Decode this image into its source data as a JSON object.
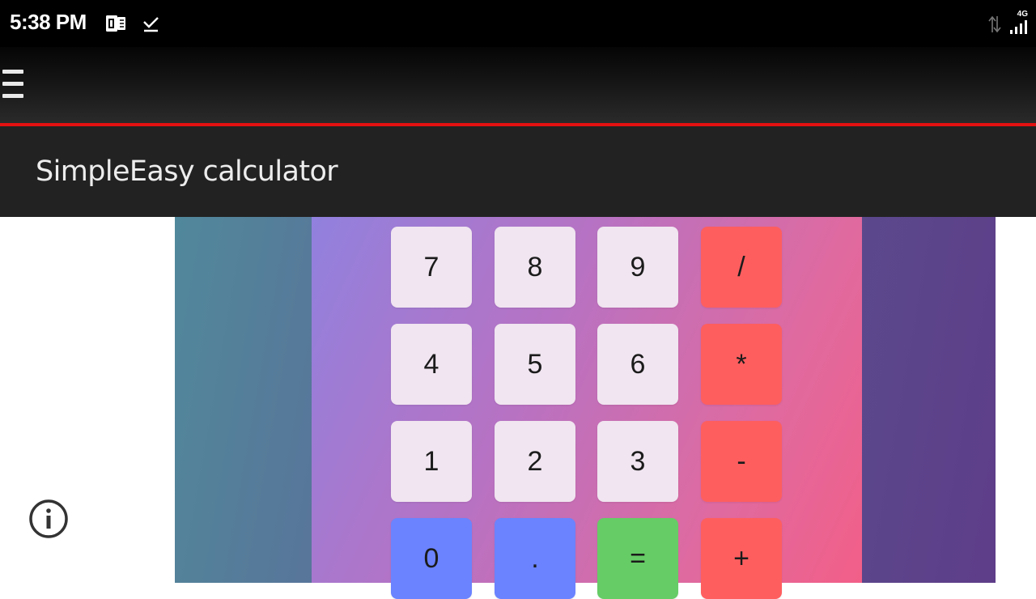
{
  "status_bar": {
    "time": "5:38 PM",
    "icons": [
      "app-notification-icon",
      "download-check-icon",
      "data-arrows-icon",
      "signal-icon"
    ],
    "network": "4G"
  },
  "toolbar": {
    "menu_icon": "hamburger-menu-icon",
    "accent_color": "#e41111"
  },
  "app": {
    "title": "SimpleEasy calculator"
  },
  "keypad": {
    "rows": [
      [
        "7",
        "8",
        "9",
        "/"
      ],
      [
        "4",
        "5",
        "6",
        "*"
      ],
      [
        "1",
        "2",
        "3",
        "-"
      ],
      [
        "0",
        ".",
        "=",
        "+"
      ]
    ],
    "colors": {
      "number": "#f0e5f0",
      "operator": "#ff5e5f",
      "zero_dot": "#6b83ff",
      "equals": "#66cc66"
    }
  },
  "info_icon": "info-icon"
}
